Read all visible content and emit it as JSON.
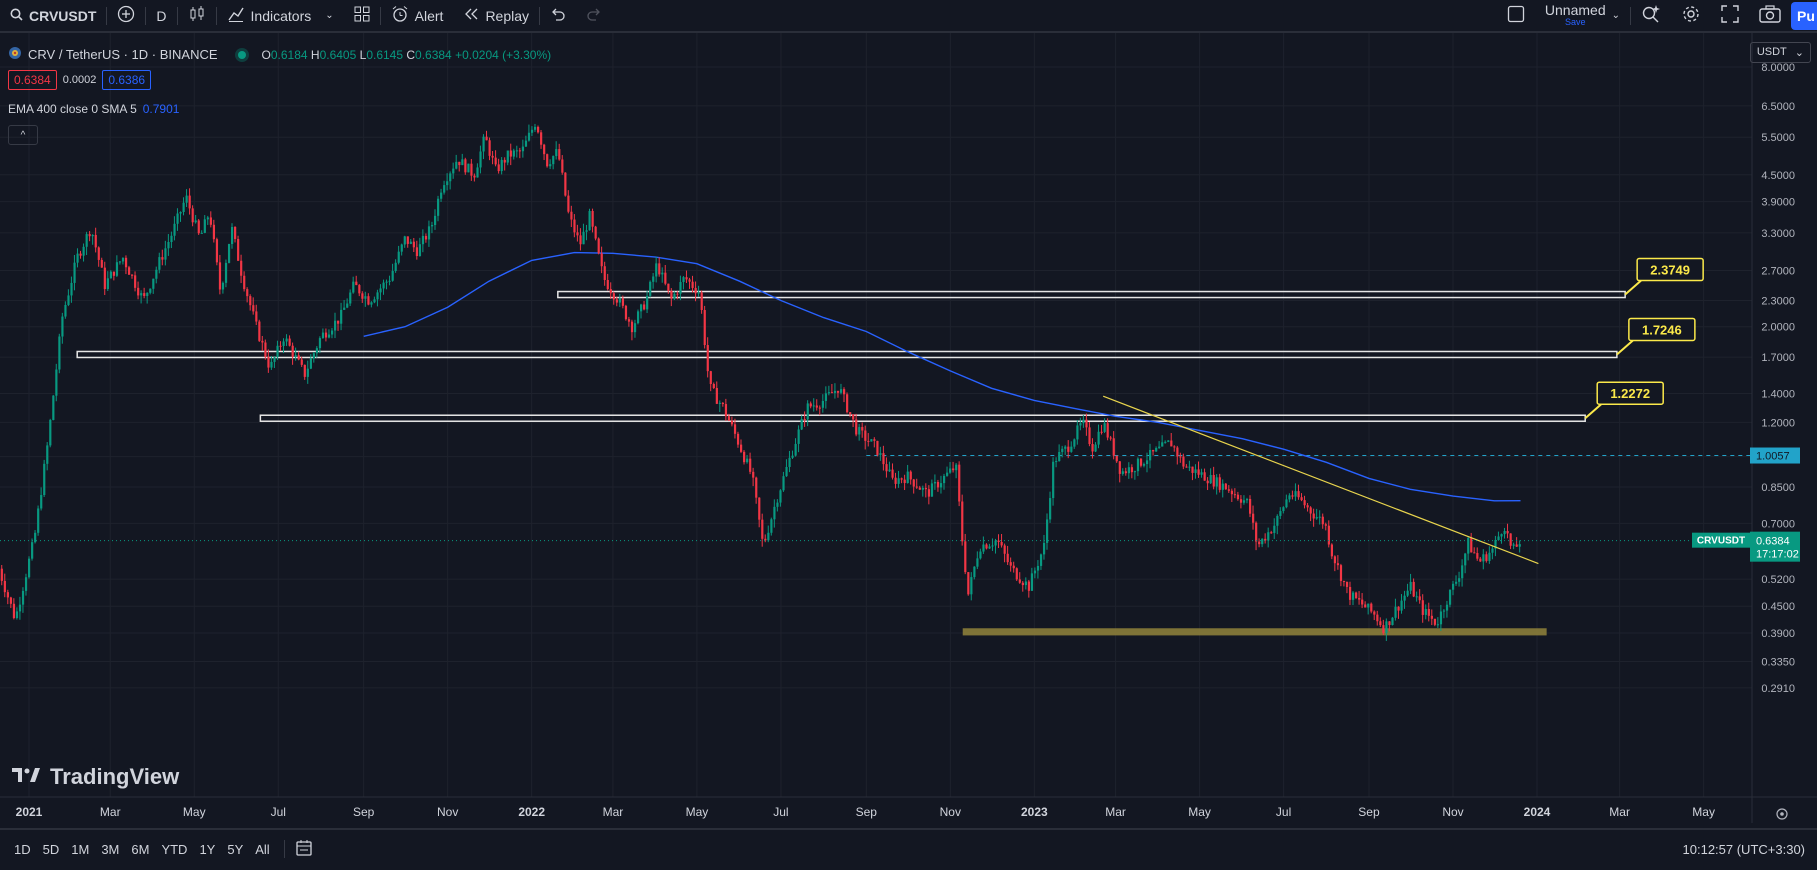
{
  "toolbar": {
    "symbol": "CRVUSDT",
    "interval": "D",
    "indicators_label": "Indicators",
    "alert_label": "Alert",
    "replay_label": "Replay",
    "layout_name": "Unnamed",
    "save_label": "Save",
    "publish_label": "Pu"
  },
  "legend": {
    "title": "CRV / TetherUS · 1D · BINANCE",
    "o_label": "O",
    "o": "0.6184",
    "h_label": "H",
    "h": "0.6405",
    "l_label": "L",
    "l": "0.6145",
    "c_label": "C",
    "c": "0.6384",
    "change": "+0.0204 (+3.30%)",
    "bid": "0.6384",
    "spread": "0.0002",
    "ask": "0.6386",
    "ema_label": "EMA 400 close 0 SMA 5",
    "ema_value": "0.7901"
  },
  "currency_selector": "USDT",
  "watermark": "TradingView",
  "timeframes": [
    "1D",
    "5D",
    "1M",
    "3M",
    "6M",
    "YTD",
    "1Y",
    "5Y",
    "All"
  ],
  "clock": "10:12:57 (UTC+3:30)",
  "colors": {
    "up": "#089981",
    "down": "#f23645",
    "ema": "#2962ff",
    "trendline": "#e8d44d",
    "callout": "#fbe94a",
    "support_zone": "#8b7d3a",
    "background": "#131722"
  },
  "chart_data": {
    "type": "candlestick",
    "symbol": "CRVUSDT",
    "scale": "log",
    "y_ticks": [
      8.0,
      6.5,
      5.5,
      4.5,
      3.9,
      3.3,
      2.7,
      2.3,
      2.0,
      1.7,
      1.4,
      1.2,
      1.0,
      0.85,
      0.7,
      0.52,
      0.45,
      0.39,
      0.335,
      0.291
    ],
    "y_tick_labels": [
      "8.0000",
      "6.5000",
      "5.5000",
      "4.5000",
      "3.9000",
      "3.3000",
      "2.7000",
      "2.3000",
      "2.0000",
      "1.7000",
      "1.4000",
      "1.2000",
      "1.0000",
      "0.8500",
      "0.7000",
      "0.5200",
      "0.4500",
      "0.3900",
      "0.3350",
      "0.2910"
    ],
    "x_ticks": [
      {
        "label": "2021",
        "date": "2021-01-01",
        "bold": true
      },
      {
        "label": "Mar",
        "date": "2021-03-01"
      },
      {
        "label": "May",
        "date": "2021-05-01"
      },
      {
        "label": "Jul",
        "date": "2021-07-01"
      },
      {
        "label": "Sep",
        "date": "2021-09-01"
      },
      {
        "label": "Nov",
        "date": "2021-11-01"
      },
      {
        "label": "2022",
        "date": "2022-01-01",
        "bold": true
      },
      {
        "label": "Mar",
        "date": "2022-03-01"
      },
      {
        "label": "May",
        "date": "2022-05-01"
      },
      {
        "label": "Jul",
        "date": "2022-07-01"
      },
      {
        "label": "Sep",
        "date": "2022-09-01"
      },
      {
        "label": "Nov",
        "date": "2022-11-01"
      },
      {
        "label": "2023",
        "date": "2023-01-01",
        "bold": true
      },
      {
        "label": "Mar",
        "date": "2023-03-01"
      },
      {
        "label": "May",
        "date": "2023-05-01"
      },
      {
        "label": "Jul",
        "date": "2023-07-01"
      },
      {
        "label": "Sep",
        "date": "2023-09-01"
      },
      {
        "label": "Nov",
        "date": "2023-11-01"
      },
      {
        "label": "2024",
        "date": "2024-01-01",
        "bold": true
      },
      {
        "label": "Mar",
        "date": "2024-03-01"
      },
      {
        "label": "May",
        "date": "2024-05-01"
      }
    ],
    "price_path": [
      [
        "2020-12-10",
        0.55
      ],
      [
        "2020-12-22",
        0.42
      ],
      [
        "2021-01-05",
        0.65
      ],
      [
        "2021-01-15",
        1.1
      ],
      [
        "2021-01-25",
        2.1
      ],
      [
        "2021-02-05",
        2.9
      ],
      [
        "2021-02-15",
        3.4
      ],
      [
        "2021-02-25",
        2.5
      ],
      [
        "2021-03-10",
        2.9
      ],
      [
        "2021-03-25",
        2.3
      ],
      [
        "2021-04-05",
        2.8
      ],
      [
        "2021-04-15",
        3.3
      ],
      [
        "2021-04-25",
        4.0
      ],
      [
        "2021-05-05",
        3.2
      ],
      [
        "2021-05-12",
        3.7
      ],
      [
        "2021-05-20",
        2.4
      ],
      [
        "2021-05-28",
        3.4
      ],
      [
        "2021-06-05",
        2.6
      ],
      [
        "2021-06-15",
        2.0
      ],
      [
        "2021-06-25",
        1.6
      ],
      [
        "2021-07-05",
        1.9
      ],
      [
        "2021-07-20",
        1.55
      ],
      [
        "2021-08-01",
        1.9
      ],
      [
        "2021-08-15",
        2.1
      ],
      [
        "2021-08-25",
        2.5
      ],
      [
        "2021-09-05",
        2.3
      ],
      [
        "2021-09-20",
        2.6
      ],
      [
        "2021-10-01",
        3.2
      ],
      [
        "2021-10-10",
        3.0
      ],
      [
        "2021-10-20",
        3.4
      ],
      [
        "2021-10-28",
        4.3
      ],
      [
        "2021-11-08",
        4.9
      ],
      [
        "2021-11-20",
        4.5
      ],
      [
        "2021-11-28",
        5.5
      ],
      [
        "2021-12-06",
        4.6
      ],
      [
        "2021-12-15",
        5.0
      ],
      [
        "2021-12-25",
        5.1
      ],
      [
        "2022-01-04",
        6.0
      ],
      [
        "2022-01-12",
        4.8
      ],
      [
        "2022-01-20",
        5.1
      ],
      [
        "2022-01-28",
        3.6
      ],
      [
        "2022-02-05",
        3.1
      ],
      [
        "2022-02-12",
        3.6
      ],
      [
        "2022-02-22",
        2.6
      ],
      [
        "2022-03-05",
        2.3
      ],
      [
        "2022-03-15",
        2.0
      ],
      [
        "2022-03-25",
        2.3
      ],
      [
        "2022-04-02",
        2.8
      ],
      [
        "2022-04-12",
        2.3
      ],
      [
        "2022-04-22",
        2.6
      ],
      [
        "2022-05-03",
        2.4
      ],
      [
        "2022-05-10",
        1.45
      ],
      [
        "2022-05-20",
        1.3
      ],
      [
        "2022-05-30",
        1.1
      ],
      [
        "2022-06-10",
        0.9
      ],
      [
        "2022-06-18",
        0.62
      ],
      [
        "2022-06-28",
        0.8
      ],
      [
        "2022-07-10",
        1.05
      ],
      [
        "2022-07-20",
        1.3
      ],
      [
        "2022-08-01",
        1.35
      ],
      [
        "2022-08-12",
        1.45
      ],
      [
        "2022-08-25",
        1.15
      ],
      [
        "2022-09-08",
        1.05
      ],
      [
        "2022-09-20",
        0.88
      ],
      [
        "2022-10-01",
        0.9
      ],
      [
        "2022-10-15",
        0.82
      ],
      [
        "2022-10-25",
        0.88
      ],
      [
        "2022-11-05",
        0.95
      ],
      [
        "2022-11-10",
        0.62
      ],
      [
        "2022-11-14",
        0.48
      ],
      [
        "2022-11-22",
        0.62
      ],
      [
        "2022-12-05",
        0.64
      ],
      [
        "2022-12-15",
        0.55
      ],
      [
        "2022-12-28",
        0.5
      ],
      [
        "2023-01-08",
        0.62
      ],
      [
        "2023-01-15",
        0.98
      ],
      [
        "2023-01-25",
        1.05
      ],
      [
        "2023-02-05",
        1.2
      ],
      [
        "2023-02-12",
        1.05
      ],
      [
        "2023-02-20",
        1.2
      ],
      [
        "2023-03-05",
        0.92
      ],
      [
        "2023-03-15",
        0.95
      ],
      [
        "2023-03-25",
        1.0
      ],
      [
        "2023-04-10",
        1.08
      ],
      [
        "2023-04-20",
        0.95
      ],
      [
        "2023-05-05",
        0.9
      ],
      [
        "2023-05-20",
        0.85
      ],
      [
        "2023-06-05",
        0.78
      ],
      [
        "2023-06-12",
        0.62
      ],
      [
        "2023-06-25",
        0.7
      ],
      [
        "2023-07-05",
        0.82
      ],
      [
        "2023-07-12",
        0.8
      ],
      [
        "2023-07-22",
        0.74
      ],
      [
        "2023-07-31",
        0.7
      ],
      [
        "2023-08-05",
        0.6
      ],
      [
        "2023-08-17",
        0.48
      ],
      [
        "2023-08-25",
        0.46
      ],
      [
        "2023-09-05",
        0.43
      ],
      [
        "2023-09-12",
        0.4
      ],
      [
        "2023-09-20",
        0.44
      ],
      [
        "2023-10-01",
        0.5
      ],
      [
        "2023-10-10",
        0.44
      ],
      [
        "2023-10-20",
        0.41
      ],
      [
        "2023-10-28",
        0.47
      ],
      [
        "2023-11-05",
        0.53
      ],
      [
        "2023-11-12",
        0.63
      ],
      [
        "2023-11-20",
        0.57
      ],
      [
        "2023-11-30",
        0.61
      ],
      [
        "2023-12-08",
        0.7
      ],
      [
        "2023-12-14",
        0.6
      ],
      [
        "2023-12-20",
        0.64
      ]
    ],
    "ema_path": [
      [
        "2021-09-01",
        1.9
      ],
      [
        "2021-10-01",
        2.0
      ],
      [
        "2021-11-01",
        2.22
      ],
      [
        "2021-12-01",
        2.55
      ],
      [
        "2022-01-01",
        2.85
      ],
      [
        "2022-02-01",
        2.97
      ],
      [
        "2022-03-01",
        2.96
      ],
      [
        "2022-04-01",
        2.9
      ],
      [
        "2022-05-01",
        2.8
      ],
      [
        "2022-06-01",
        2.55
      ],
      [
        "2022-07-01",
        2.3
      ],
      [
        "2022-08-01",
        2.1
      ],
      [
        "2022-09-01",
        1.95
      ],
      [
        "2022-10-01",
        1.75
      ],
      [
        "2022-11-01",
        1.58
      ],
      [
        "2022-12-01",
        1.44
      ],
      [
        "2023-01-01",
        1.35
      ],
      [
        "2023-02-01",
        1.29
      ],
      [
        "2023-03-01",
        1.24
      ],
      [
        "2023-04-01",
        1.2
      ],
      [
        "2023-05-01",
        1.15
      ],
      [
        "2023-06-01",
        1.1
      ],
      [
        "2023-07-01",
        1.04
      ],
      [
        "2023-08-01",
        0.97
      ],
      [
        "2023-09-01",
        0.89
      ],
      [
        "2023-10-01",
        0.84
      ],
      [
        "2023-11-01",
        0.81
      ],
      [
        "2023-12-01",
        0.79
      ],
      [
        "2023-12-20",
        0.7901
      ]
    ],
    "levels": [
      {
        "label": "2.3749",
        "value": 2.3749,
        "from": "2022-01-20",
        "to": "2024-03-05"
      },
      {
        "label": "1.7246",
        "value": 1.7246,
        "from": "2021-02-05",
        "to": "2024-02-28"
      },
      {
        "label": "1.2272",
        "value": 1.2272,
        "from": "2021-06-18",
        "to": "2024-02-05"
      }
    ],
    "support_zone": {
      "low": 0.385,
      "high": 0.4,
      "from": "2022-11-10",
      "to": "2024-01-08"
    },
    "trendline": {
      "from": [
        "2023-02-20",
        1.38
      ],
      "to": [
        "2024-01-02",
        0.565
      ]
    },
    "dashed_level": {
      "label": "1.0057",
      "value": 1.0057,
      "from": "2022-09-01"
    },
    "last_price": {
      "symbol": "CRVUSDT",
      "value": 0.6384,
      "label": "0.6384",
      "countdown": "17:17:02"
    }
  }
}
